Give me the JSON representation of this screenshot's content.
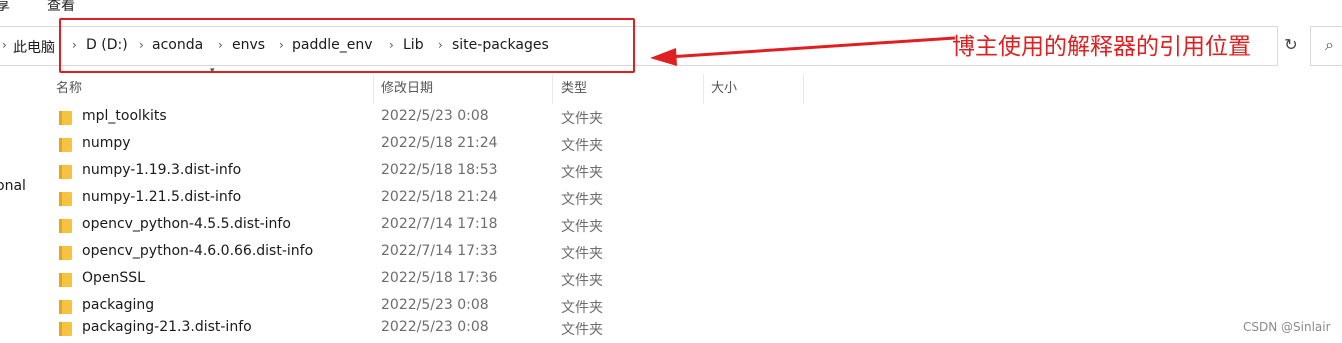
{
  "menu": [
    "享",
    "查看"
  ],
  "address_bar": {
    "breadcrumbs": [
      "此电脑",
      "D (D:)",
      "aconda",
      "envs",
      "paddle_env",
      "Lib",
      "site-packages"
    ]
  },
  "annotation": {
    "text": "博主使用的解释器的引用位置",
    "color": "#e02020"
  },
  "nav_pane": {
    "fragment": "onal"
  },
  "columns": [
    "名称",
    "修改日期",
    "类型",
    "大小"
  ],
  "files": [
    {
      "name": "mpl_toolkits",
      "date": "2022/5/23 0:08",
      "type": "文件夹"
    },
    {
      "name": "numpy",
      "date": "2022/5/18 21:24",
      "type": "文件夹"
    },
    {
      "name": "numpy-1.19.3.dist-info",
      "date": "2022/5/18 18:53",
      "type": "文件夹"
    },
    {
      "name": "numpy-1.21.5.dist-info",
      "date": "2022/5/18 21:24",
      "type": "文件夹"
    },
    {
      "name": "opencv_python-4.5.5.dist-info",
      "date": "2022/7/14 17:18",
      "type": "文件夹"
    },
    {
      "name": "opencv_python-4.6.0.66.dist-info",
      "date": "2022/7/14 17:33",
      "type": "文件夹"
    },
    {
      "name": "OpenSSL",
      "date": "2022/5/18 17:36",
      "type": "文件夹"
    },
    {
      "name": "packaging",
      "date": "2022/5/23 0:08",
      "type": "文件夹"
    },
    {
      "name": "packaging-21.3.dist-info",
      "date": "2022/5/23 0:08",
      "type": "文件夹"
    }
  ],
  "icons": {
    "folder": "folder-icon",
    "chevron": "chevron-right-icon",
    "refresh": "refresh-icon",
    "search": "search-icon"
  },
  "colors": {
    "folder": "#f5c242",
    "annotation": "#e02020"
  },
  "watermark": "CSDN @Sinlair"
}
